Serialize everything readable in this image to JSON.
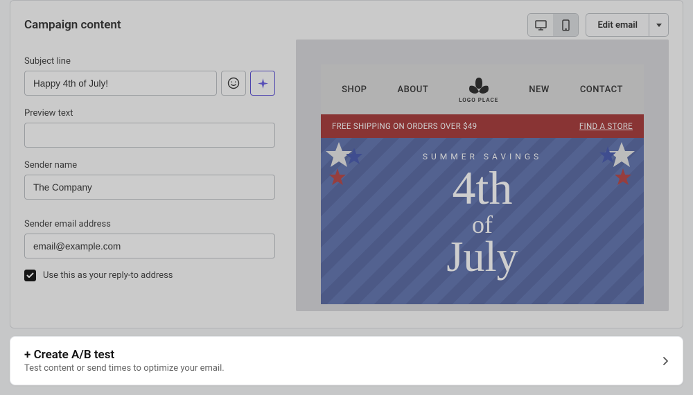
{
  "header": {
    "title": "Campaign content",
    "edit_label": "Edit email"
  },
  "form": {
    "subject_label": "Subject line",
    "subject_value": "Happy 4th of July!",
    "preview_label": "Preview text",
    "preview_value": "",
    "sender_name_label": "Sender name",
    "sender_name_value": "The Company",
    "sender_email_label": "Sender email address",
    "sender_email_value": "email@example.com",
    "replyto_label": "Use this as your reply-to address",
    "replyto_checked": true
  },
  "email_preview": {
    "nav": {
      "shop": "SHOP",
      "about": "ABOUT",
      "new": "NEW",
      "contact": "CONTACT"
    },
    "logo_text": "LOGO PLACE",
    "banner_text": "FREE SHIPPING ON ORDERS OVER $49",
    "banner_link": "FIND A STORE",
    "hero_eyebrow": "SUMMER SAVINGS",
    "hero_line1": "4th",
    "hero_line2": "of",
    "hero_line3": "July"
  },
  "ab": {
    "title": "+ Create A/B test",
    "subtitle": "Test content or send times to optimize your email."
  }
}
